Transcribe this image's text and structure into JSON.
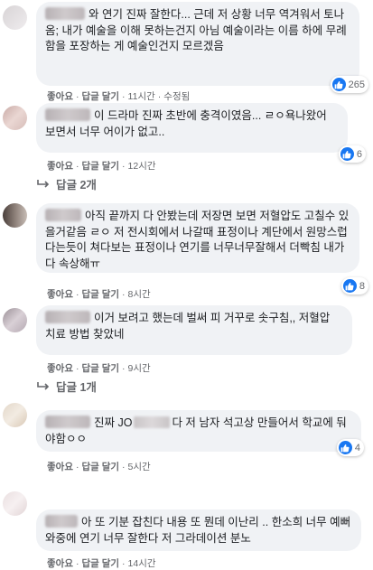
{
  "colors": {
    "bubble": "#f0f2f5",
    "action_text": "#65676b",
    "like_blue": "#1877f2"
  },
  "action_labels": {
    "like": "좋아요",
    "reply": "답글 달기",
    "edited": "수정됨"
  },
  "comments": [
    {
      "text": "와 연기 진짜 잘한다... 근데 저 상황 너무 역겨워서 토나옴; 내가 예술을 이해 못하는건지 아님 예술이라는 이름 하에 무례함을 포장하는 게 예술인건지 모르겠음",
      "time": "11시간",
      "reactions": "265"
    },
    {
      "text": "이 드라마 진짜 초반에 충격이였음... ㄹㅇ욕나왔어 보면서 너무 어이가 없고..",
      "time": "12시간",
      "reactions": "6",
      "replies": "답글 2개"
    },
    {
      "text": "아직 끝까지 다 안봤는데 저장면 보면 저혈압도 고칠수 있을거같음 ㄹㅇ 저 전시회에서 나갈때 표정이나 계단에서 원망스럽다는듯이 쳐다보는 표정이나 연기를 너무너무잘해서 더빡침 내가 다 속상해ㅠ",
      "time": "8시간",
      "reactions": "8"
    },
    {
      "text": "이거 보려고 했는데 벌써 피 거꾸로 솟구침,, 저혈압 치료 방법 찾았네",
      "time": "9시간",
      "replies": "답글 1개"
    },
    {
      "text_before": "진짜 JO",
      "text_after": "다 저 남자 석고상 만들어서 학교에 둬야함ㅇㅇ",
      "time": "5시간",
      "reactions": "4"
    },
    {
      "text": "아 또 기분 잡친다 내용 또 뭔데 이난리 .. 한소희 너무 예뻐 와중에 연기 너무 잘한다 저 그라데이션 분노",
      "time": "14시간"
    }
  ]
}
